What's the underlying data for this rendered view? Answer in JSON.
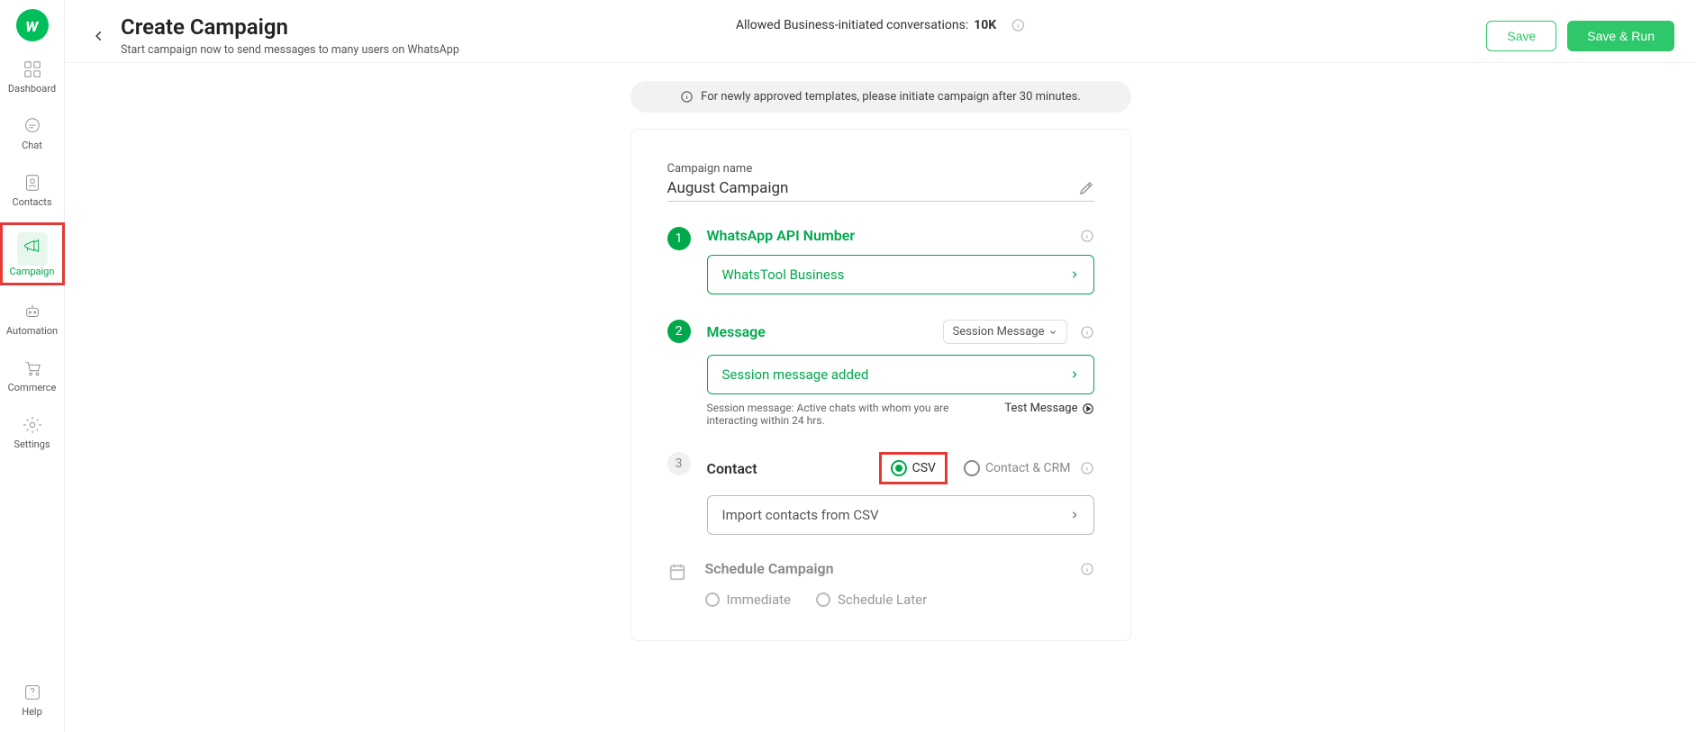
{
  "sidebar": {
    "items": [
      {
        "label": "Dashboard"
      },
      {
        "label": "Chat"
      },
      {
        "label": "Contacts"
      },
      {
        "label": "Campaign"
      },
      {
        "label": "Automation"
      },
      {
        "label": "Commerce"
      },
      {
        "label": "Settings"
      }
    ],
    "help_label": "Help"
  },
  "header": {
    "title": "Create Campaign",
    "subtitle": "Start campaign now to send messages to many users on WhatsApp",
    "allowed_prefix": "Allowed Business-initiated conversations: ",
    "allowed_value": "10K",
    "save_label": "Save",
    "save_run_label": "Save & Run"
  },
  "notice": "For newly approved templates, please initiate campaign after 30 minutes.",
  "form": {
    "campaign_name_label": "Campaign name",
    "campaign_name_value": "August Campaign",
    "steps": {
      "api_number": {
        "num": "1",
        "title": "WhatsApp API Number",
        "selected": "WhatsTool Business"
      },
      "message": {
        "num": "2",
        "title": "Message",
        "type_label": "Session Message",
        "selected": "Session message added",
        "note": "Session message: Active chats with whom you are interacting within 24 hrs.",
        "test_label": "Test Message"
      },
      "contact": {
        "num": "3",
        "title": "Contact",
        "csv_label": "CSV",
        "crm_label": "Contact & CRM",
        "import_label": "Import contacts from CSV"
      },
      "schedule": {
        "title": "Schedule Campaign",
        "immediate_label": "Immediate",
        "later_label": "Schedule Later"
      }
    }
  }
}
